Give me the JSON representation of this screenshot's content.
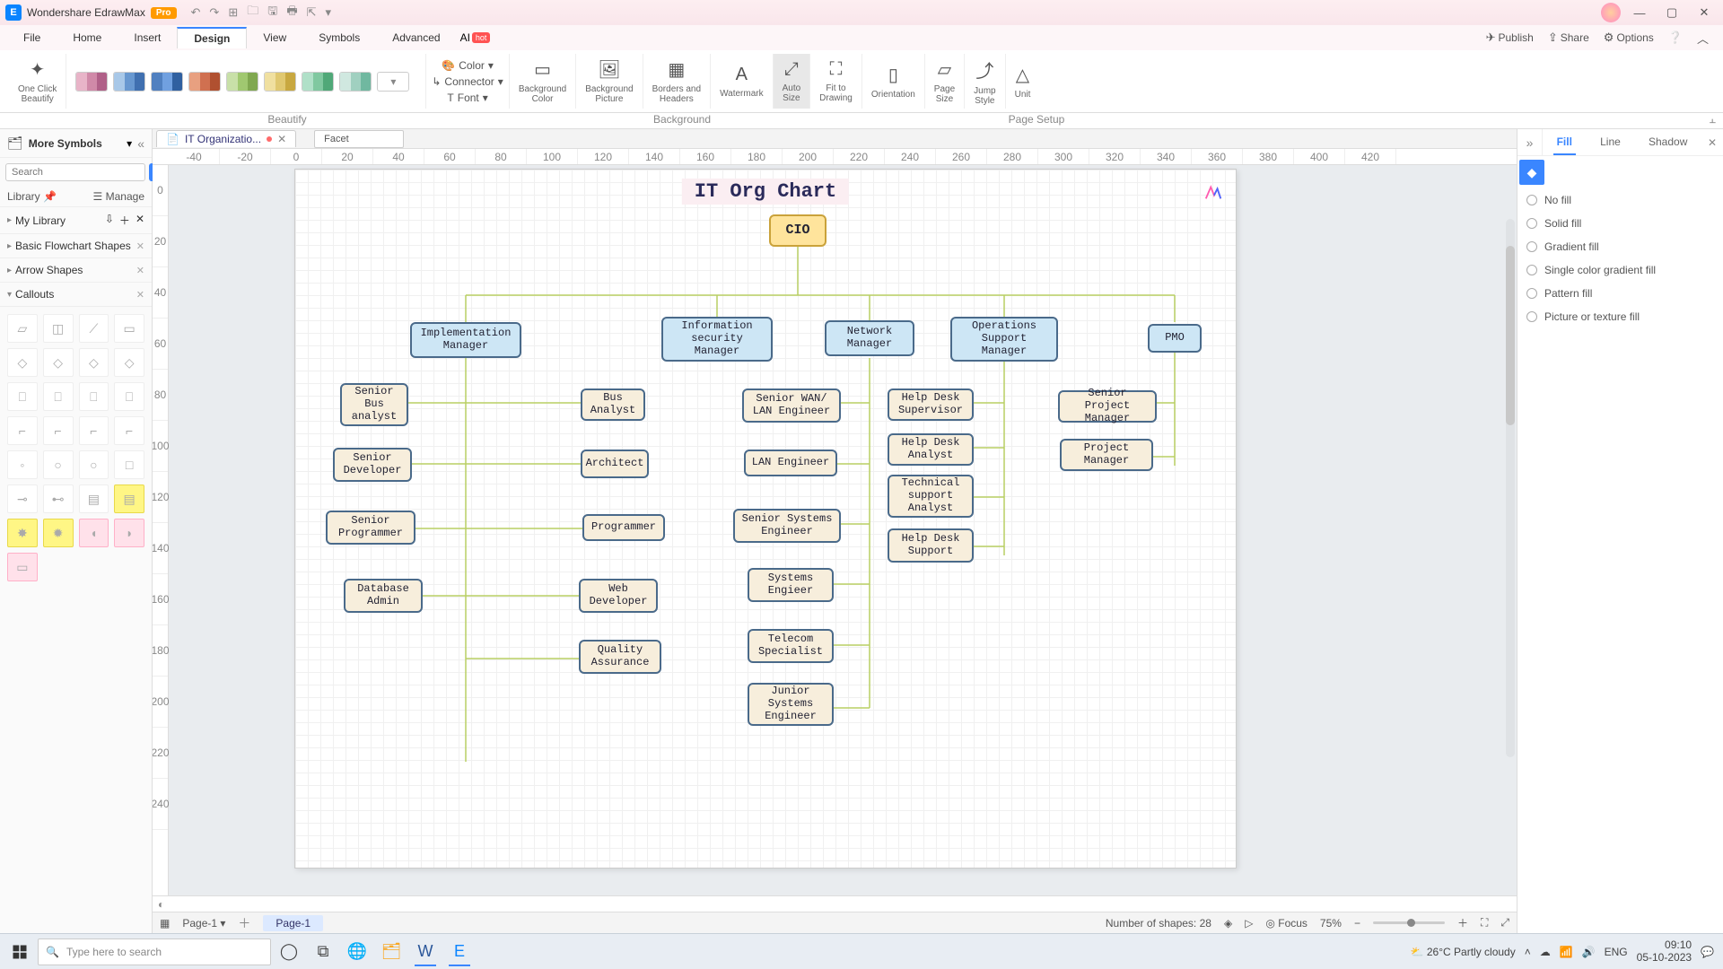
{
  "titlebar": {
    "app": "Wondershare EdrawMax",
    "badge": "Pro"
  },
  "menus": [
    "File",
    "Home",
    "Insert",
    "Design",
    "View",
    "Symbols",
    "Advanced"
  ],
  "ai": {
    "label": "AI",
    "hot": "hot"
  },
  "top_right": {
    "publish": "Publish",
    "share": "Share",
    "options": "Options"
  },
  "ribbon": {
    "oneclick": "One Click\nBeautify",
    "mini": {
      "color": "Color",
      "connector": "Connector",
      "font": "Font"
    },
    "bgcolor": "Background\nColor",
    "bgpic": "Background\nPicture",
    "borders": "Borders and\nHeaders",
    "watermark": "Watermark",
    "autosize": "Auto\nSize",
    "fit": "Fit to\nDrawing",
    "orient": "Orientation",
    "pagesize": "Page\nSize",
    "jump": "Jump\nStyle",
    "unit": "Unit",
    "groups": {
      "beautify": "Beautify",
      "background": "Background",
      "pagesetup": "Page Setup"
    }
  },
  "left": {
    "title": "More Symbols",
    "search_ph": "Search",
    "search_btn": "Search",
    "library": "Library",
    "manage": "Manage",
    "mylib": "My Library",
    "sections": [
      "Basic Flowchart Shapes",
      "Arrow Shapes",
      "Callouts"
    ]
  },
  "doc": {
    "tab": "IT Organizatio...",
    "theme": "Facet"
  },
  "rulerH": [
    "-40",
    "-20",
    "0",
    "20",
    "40",
    "60",
    "80",
    "100",
    "120",
    "140",
    "160",
    "180",
    "200",
    "220",
    "240",
    "260",
    "280",
    "300",
    "320",
    "340",
    "360",
    "380",
    "400",
    "420"
  ],
  "rulerV": [
    "0",
    "20",
    "40",
    "60",
    "80",
    "100",
    "120",
    "140",
    "160",
    "180",
    "200",
    "220",
    "240"
  ],
  "chart": {
    "title": "IT Org Chart",
    "nodes": {
      "cio": "CIO",
      "impl": "Implementation\nManager",
      "info": "Information\nsecurity\nManager",
      "net": "Network\nManager",
      "ops": "Operations\nSupport\nManager",
      "pmo": "PMO",
      "sba": "Senior\nBus\nanalyst",
      "ba": "Bus\nAnalyst",
      "swl": "Senior WAN/\nLAN Engineer",
      "hds": "Help Desk\nSupervisor",
      "spm": "Senior Project\nManager",
      "sdev": "Senior\nDeveloper",
      "arch": "Architect",
      "lan": "LAN Engineer",
      "hda": "Help Desk\nAnalyst",
      "pm": "Project\nManager",
      "sprog": "Senior\nProgrammer",
      "prog": "Programmer",
      "sse": "Senior Systems\nEngineer",
      "tsa": "Technical\nsupport\nAnalyst",
      "dba": "Database\nAdmin",
      "web": "Web\nDeveloper",
      "se": "Systems\nEngieer",
      "hdsu": "Help Desk\nSupport",
      "qa": "Quality\nAssurance",
      "tel": "Telecom\nSpecialist",
      "jse": "Junior\nSystems\nEngineer"
    }
  },
  "right": {
    "tabs": [
      "Fill",
      "Line",
      "Shadow"
    ],
    "opts": [
      "No fill",
      "Solid fill",
      "Gradient fill",
      "Single color gradient fill",
      "Pattern fill",
      "Picture or texture fill"
    ]
  },
  "colorbar": [
    "#9b1c1c",
    "#c0392b",
    "#e74c3c",
    "#ec7063",
    "#f1948a",
    "#3498db",
    "#5dade2",
    "#85c1e9",
    "#1abc9c",
    "#48c9b0",
    "#f39c12",
    "#f5b041",
    "#f8c471",
    "#27ae60",
    "#2ecc71",
    "#58d68d",
    "#8e44ad",
    "#9b59b6",
    "#af7ac5",
    "#2c3e50",
    "#34495e",
    "#5d6d7e",
    "#d35400",
    "#e67e22",
    "#eb984e",
    "#16a085",
    "#7d3c98",
    "#6c3483",
    "#c39bd3",
    "#f1c40f",
    "#f4d03f",
    "#f7dc6f",
    "#196f3d",
    "#239b56",
    "#7dcea0",
    "#1f618d",
    "#2874a6",
    "#5499c7",
    "#7b241c",
    "#922b21",
    "#cb4335",
    "#6e2c00",
    "#873600",
    "#a04000",
    "#0b5345",
    "#117864",
    "#148f77",
    "#4a235a",
    "#5b2c6f",
    "#76448a",
    "#7e5109",
    "#9a7d0a",
    "#b7950b",
    "#145a32",
    "#1d8348",
    "#28b463",
    "#1a5276",
    "#21618c",
    "#2e86c1",
    "#641e16",
    "#7b241c",
    "#943126",
    "#212f3c",
    "#283747",
    "#2e4053",
    "#000000",
    "#1c1c1c",
    "#383838",
    "#545454",
    "#707070",
    "#8c8c8c",
    "#a8a8a8",
    "#c4c4c4",
    "#e0e0e0",
    "#ffffff"
  ],
  "status": {
    "page": "Page-1",
    "pagelabel": "Page-1",
    "shapes": "Number of shapes: 28",
    "focus": "Focus",
    "zoom": "75%"
  },
  "taskbar": {
    "search_ph": "Type here to search",
    "weather": "26°C  Partly cloudy",
    "time": "09:10",
    "date": "05-10-2023"
  }
}
